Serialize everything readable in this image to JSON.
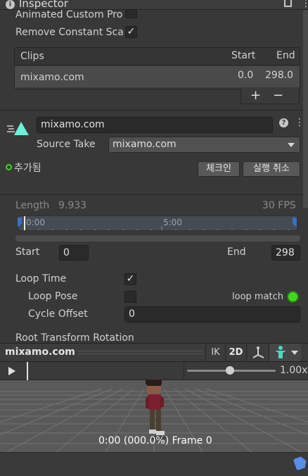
{
  "tab": {
    "title": "Inspector"
  },
  "importer": {
    "animated_custom_props": "Animated Custom Pro",
    "remove_constant_scale": "Remove Constant Sca",
    "remove_constant_scale_checked": "✓"
  },
  "clips": {
    "header_clips": "Clips",
    "header_start": "Start",
    "header_end": "End",
    "rows": [
      {
        "name": "mixamo.com",
        "start": "0.0",
        "end": "298.0"
      }
    ],
    "add": "+",
    "remove": "−"
  },
  "clip": {
    "name": "mixamo.com",
    "source_take_label": "Source Take",
    "source_take_value": "mixamo.com",
    "added_label": "추가됨",
    "checkin_button": "체크인",
    "revert_button": "실행 취소"
  },
  "timeline": {
    "length_label": "Length",
    "length_value": "9.933",
    "fps": "30 FPS",
    "tick_0": "0:00",
    "tick_5": "5:00",
    "start_label": "Start",
    "start_value": "0",
    "end_label": "End",
    "end_value": "298"
  },
  "loop": {
    "loop_time_label": "Loop Time",
    "loop_time_checked": "✓",
    "loop_pose_label": "Loop Pose",
    "loop_match_label": "loop match",
    "cycle_offset_label": "Cycle Offset",
    "cycle_offset_value": "0",
    "root_transform_label": "Root Transform Rotation"
  },
  "preview": {
    "title": "mixamo.com",
    "ik": "IK",
    "mode_2d": "2D",
    "speed": "1.00x",
    "status": "0:00 (000.0%) Frame 0"
  },
  "colors": {
    "accent_green": "#41d821",
    "teal_icon": "#6cf0d8",
    "tag_blue": "#5a8fe6"
  }
}
